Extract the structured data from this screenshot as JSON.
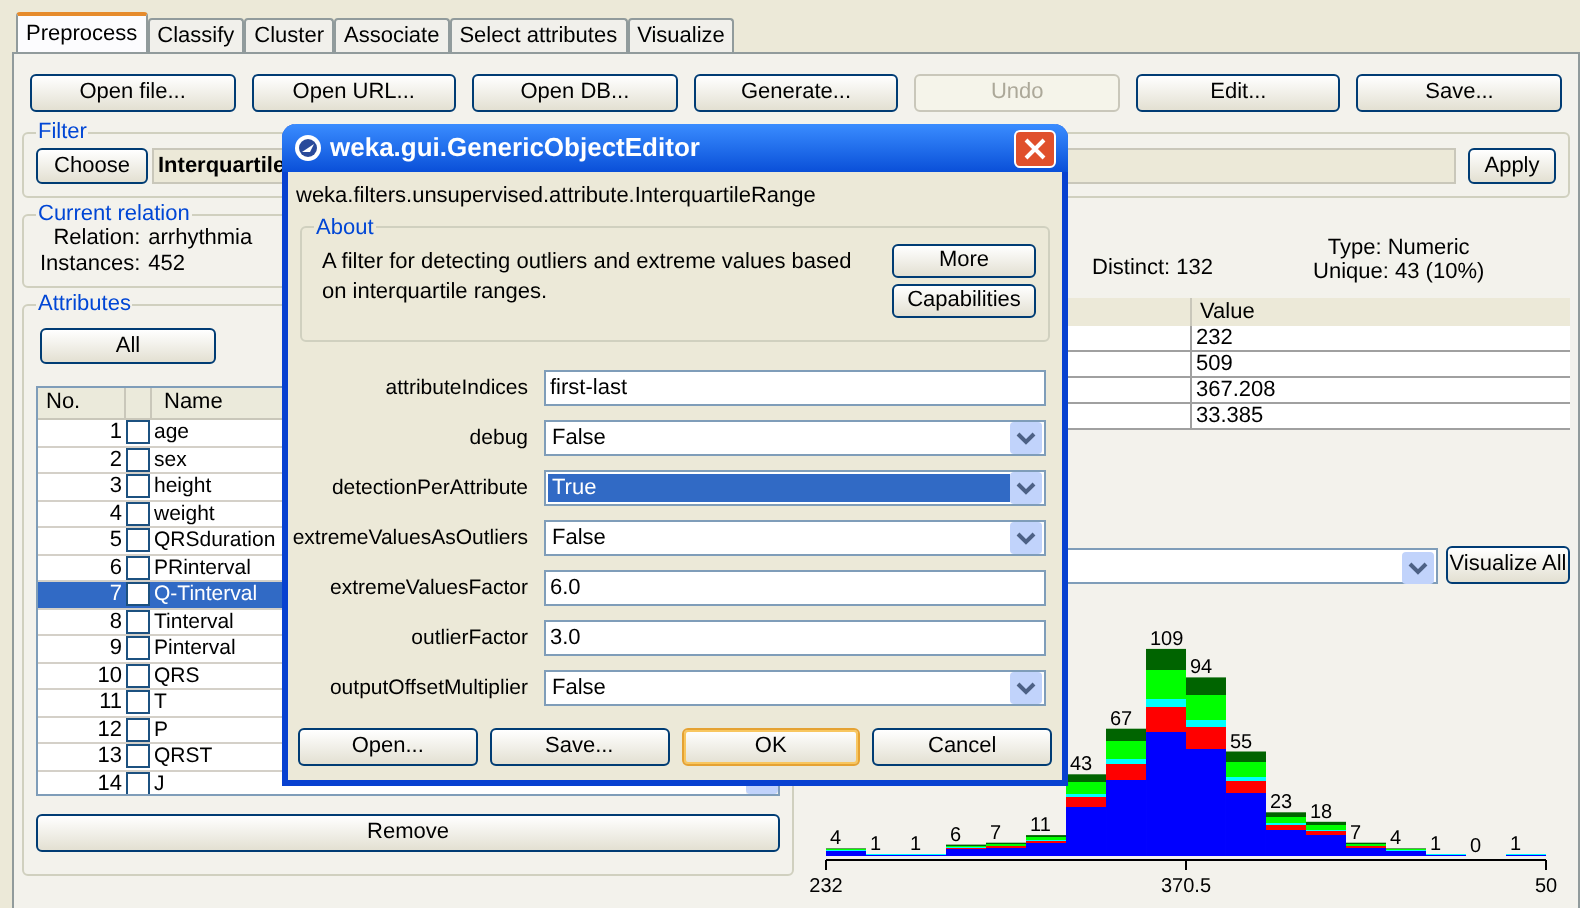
{
  "tabs": [
    {
      "label": "Preprocess",
      "selected": true
    },
    {
      "label": "Classify",
      "selected": false
    },
    {
      "label": "Cluster",
      "selected": false
    },
    {
      "label": "Associate",
      "selected": false
    },
    {
      "label": "Select attributes",
      "selected": false
    },
    {
      "label": "Visualize",
      "selected": false
    }
  ],
  "toolbar": [
    {
      "label": "Open file...",
      "disabled": false
    },
    {
      "label": "Open URL...",
      "disabled": false
    },
    {
      "label": "Open DB...",
      "disabled": false
    },
    {
      "label": "Generate...",
      "disabled": false
    },
    {
      "label": "Undo",
      "disabled": true
    },
    {
      "label": "Edit...",
      "disabled": false
    },
    {
      "label": "Save...",
      "disabled": false
    }
  ],
  "filter": {
    "title": "Filter",
    "choose": "Choose",
    "value": "Interquartile",
    "apply": "Apply"
  },
  "current_relation": {
    "title": "Current relation",
    "relation_label": "Relation:",
    "relation": "arrhythmia",
    "instances_label": "Instances:",
    "instances": "452"
  },
  "attributes": {
    "title": "Attributes",
    "all": "All",
    "columns": [
      "No.",
      "Name"
    ],
    "remove": "Remove",
    "rows": [
      {
        "no": "1",
        "name": "age",
        "checked": false,
        "selected": false
      },
      {
        "no": "2",
        "name": "sex",
        "checked": false,
        "selected": false
      },
      {
        "no": "3",
        "name": "height",
        "checked": false,
        "selected": false
      },
      {
        "no": "4",
        "name": "weight",
        "checked": false,
        "selected": false
      },
      {
        "no": "5",
        "name": "QRSduration",
        "checked": false,
        "selected": false
      },
      {
        "no": "6",
        "name": "PRinterval",
        "checked": false,
        "selected": false
      },
      {
        "no": "7",
        "name": "Q-Tinterval",
        "checked": false,
        "selected": true
      },
      {
        "no": "8",
        "name": "Tinterval",
        "checked": false,
        "selected": false
      },
      {
        "no": "9",
        "name": "Pinterval",
        "checked": false,
        "selected": false
      },
      {
        "no": "10",
        "name": "QRS",
        "checked": false,
        "selected": false
      },
      {
        "no": "11",
        "name": "T",
        "checked": false,
        "selected": false
      },
      {
        "no": "12",
        "name": "P",
        "checked": false,
        "selected": false
      },
      {
        "no": "13",
        "name": "QRST",
        "checked": false,
        "selected": false
      },
      {
        "no": "14",
        "name": "J",
        "checked": false,
        "selected": false
      }
    ]
  },
  "selected_attribute": {
    "distinct": "Distinct: 132",
    "type": "Type: Numeric",
    "unique": "Unique: 43 (10%)",
    "value_header": "Value",
    "values": [
      "232",
      "509",
      "367.208",
      "33.385"
    ]
  },
  "class_select": {
    "visualize_all": "Visualize All"
  },
  "histogram": {
    "axis_end_label": "50",
    "chart_data": {
      "type": "bar",
      "stacked": true,
      "x": [
        239.69,
        255.08,
        270.47,
        285.86,
        301.25,
        316.64,
        332.03,
        347.42,
        362.81,
        378.19,
        393.58,
        408.97,
        424.36,
        439.75,
        455.14,
        470.53,
        485.92,
        501.31
      ],
      "data_labels": true,
      "xlim": [
        232,
        509
      ],
      "xticks": [
        {
          "value": 232,
          "label": "232"
        },
        {
          "value": 370.5,
          "label": "370.5"
        }
      ],
      "values": [
        4,
        1,
        1,
        6,
        7,
        11,
        43,
        67,
        109,
        94,
        55,
        23,
        18,
        7,
        4,
        1,
        0,
        1
      ]
    }
  },
  "dialog": {
    "title": "weka.gui.GenericObjectEditor",
    "class_name": "weka.filters.unsupervised.attribute.InterquartileRange",
    "about": {
      "title": "About",
      "text": "A filter for detecting outliers and extreme values based on interquartile ranges.",
      "buttons": [
        "More",
        "Capabilities"
      ]
    },
    "properties": [
      {
        "label": "attributeIndices",
        "kind": "text",
        "value": "first-last",
        "selected": false
      },
      {
        "label": "debug",
        "kind": "select",
        "value": "False",
        "selected": false
      },
      {
        "label": "detectionPerAttribute",
        "kind": "select",
        "value": "True",
        "selected": true
      },
      {
        "label": "extremeValuesAsOutliers",
        "kind": "select",
        "value": "False",
        "selected": false
      },
      {
        "label": "extremeValuesFactor",
        "kind": "text",
        "value": "6.0",
        "selected": false
      },
      {
        "label": "outlierFactor",
        "kind": "text",
        "value": "3.0",
        "selected": false
      },
      {
        "label": "outputOffsetMultiplier",
        "kind": "select",
        "value": "False",
        "selected": false
      }
    ],
    "buttons": [
      {
        "label": "Open...",
        "default": false
      },
      {
        "label": "Save...",
        "default": false
      },
      {
        "label": "OK",
        "default": true
      },
      {
        "label": "Cancel",
        "default": false
      }
    ]
  }
}
